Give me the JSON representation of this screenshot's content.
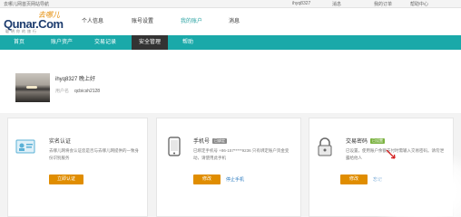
{
  "topbar": {
    "left": "去哪儿网首页",
    "site_nav": "网站导航",
    "user": "ihyq8327",
    "messages": "消息",
    "orders": "我的订单",
    "help": "帮助中心"
  },
  "logo": {
    "mascot": "去哪儿",
    "main": "Qunar.Com",
    "sub": "聪明你的旅行"
  },
  "header_nav": [
    {
      "label": "个人信息"
    },
    {
      "label": "账号设置"
    },
    {
      "label": "我的账户"
    },
    {
      "label": "消息"
    }
  ],
  "nav": [
    {
      "label": "首页"
    },
    {
      "label": "账户资产"
    },
    {
      "label": "交易记录"
    },
    {
      "label": "安全管理"
    },
    {
      "label": "帮助"
    }
  ],
  "profile": {
    "greeting": "ihyq8327   晚上好",
    "userid_label": "用户名",
    "userid_value": "qcbicsh2128"
  },
  "cards": [
    {
      "title": "实名认证",
      "badge": "",
      "desc": "去哪儿网将会认证您是否与去哪儿网提供的一致身份识别服务",
      "button": "立即认证",
      "link": "",
      "icon": "id-card-icon"
    },
    {
      "title": "手机号",
      "badge": "已绑定",
      "desc": "已绑定手机号 +86-157*****9236 只有绑定账户资金变动，请使用此手机",
      "button": "修改",
      "link": "停止手机",
      "icon": "mobile-phone-icon"
    },
    {
      "title": "交易密码",
      "badge": "已设置",
      "desc": "已设置，使用账户余额支付时需输入交易密码。请勿泄露给他人",
      "button": "修改",
      "link": "忘记",
      "icon": "lock-icon"
    }
  ],
  "colors": {
    "nav_bg": "#1aa9a9",
    "nav_active": "#333333",
    "button": "#e08d00",
    "link": "#2a7ac0"
  }
}
